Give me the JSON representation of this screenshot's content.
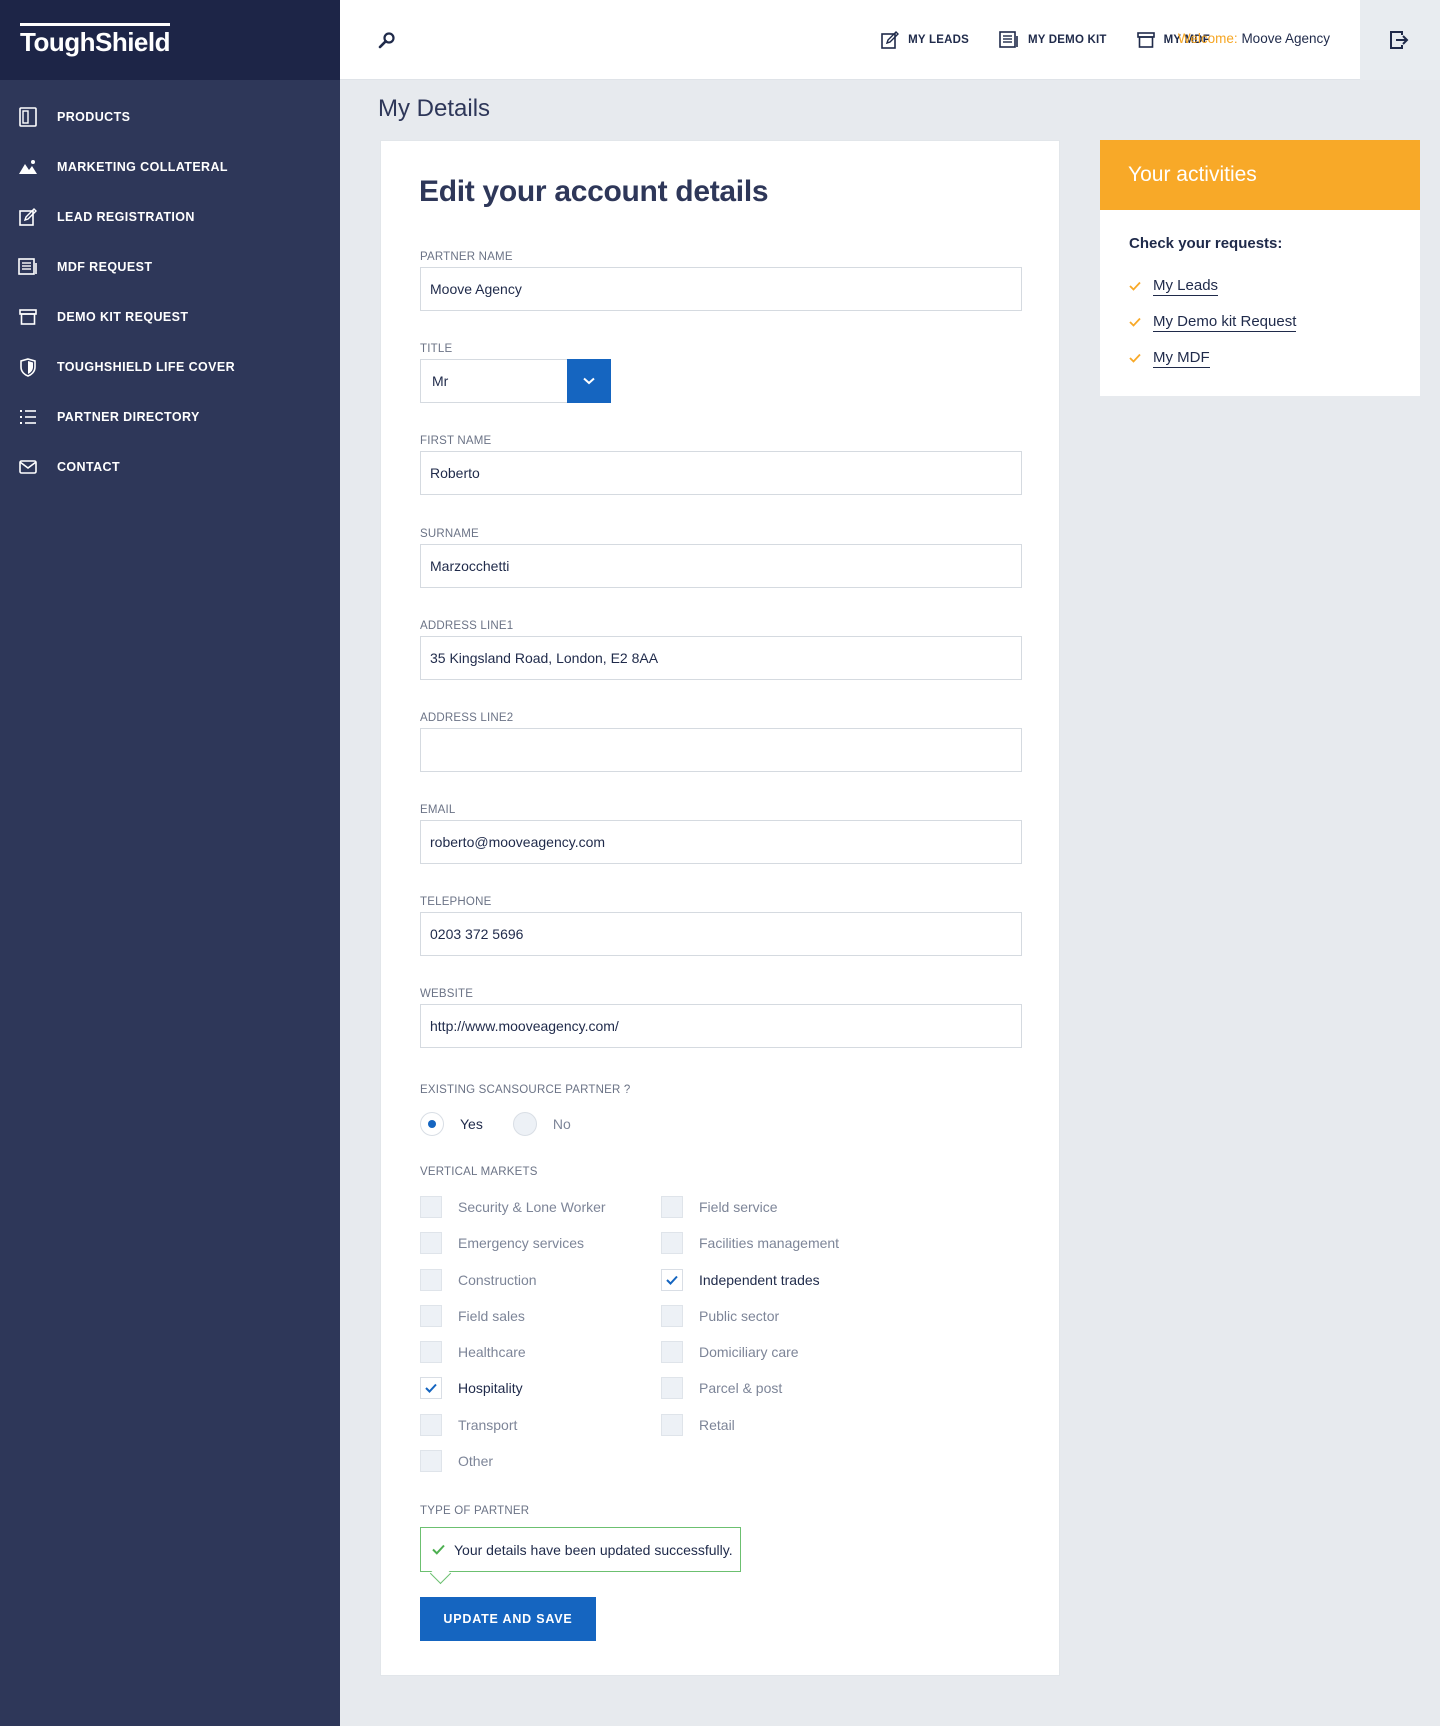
{
  "brand": {
    "logo_text": "ToughShield"
  },
  "sidebar": {
    "items": [
      {
        "label": "PRODUCTS",
        "icon": "tablet-icon"
      },
      {
        "label": "MARKETING COLLATERAL",
        "icon": "image-icon"
      },
      {
        "label": "LEAD REGISTRATION",
        "icon": "edit-icon"
      },
      {
        "label": "MDF REQUEST",
        "icon": "newspaper-icon"
      },
      {
        "label": "DEMO KIT REQUEST",
        "icon": "archive-box-icon"
      },
      {
        "label": "TOUGHSHIELD LIFE COVER",
        "icon": "shield-icon"
      },
      {
        "label": "PARTNER DIRECTORY",
        "icon": "list-icon"
      },
      {
        "label": "CONTACT",
        "icon": "envelope-icon"
      }
    ]
  },
  "header": {
    "nav": [
      {
        "label": "MY LEADS",
        "icon": "edit-icon"
      },
      {
        "label": "MY DEMO KIT",
        "icon": "newspaper-icon"
      },
      {
        "label": "MY MDF",
        "icon": "archive-box-icon"
      }
    ],
    "welcome_label": "Welcome:",
    "welcome_name": "Moove Agency",
    "search_icon": "search-icon",
    "logout_icon": "logout-icon"
  },
  "page": {
    "title": "My Details"
  },
  "form": {
    "heading": "Edit your account details",
    "partner_name": {
      "label": "PARTNER NAME",
      "value": "Moove Agency"
    },
    "title": {
      "label": "TITLE",
      "value": "Mr"
    },
    "first_name": {
      "label": "FIRST NAME",
      "value": "Roberto"
    },
    "surname": {
      "label": "SURNAME",
      "value": "Marzocchetti"
    },
    "address1": {
      "label": "ADDRESS LINE1",
      "value": "35 Kingsland Road, London, E2 8AA"
    },
    "address2": {
      "label": "ADDRESS LINE2",
      "value": ""
    },
    "email": {
      "label": "EMAIL",
      "value": "roberto@mooveagency.com"
    },
    "telephone": {
      "label": "TELEPHONE",
      "value": "0203 372 5696"
    },
    "website": {
      "label": "WEBSITE",
      "value": "http://www.mooveagency.com/"
    },
    "existing_partner": {
      "label": "EXISTING SCANSOURCE PARTNER ?",
      "options": [
        {
          "label": "Yes",
          "selected": true
        },
        {
          "label": "No",
          "selected": false
        }
      ]
    },
    "vertical_markets": {
      "label": "VERTICAL MARKETS",
      "left": [
        {
          "label": "Security & Lone Worker",
          "checked": false
        },
        {
          "label": "Emergency services",
          "checked": false
        },
        {
          "label": "Construction",
          "checked": false
        },
        {
          "label": "Field sales",
          "checked": false
        },
        {
          "label": "Healthcare",
          "checked": false
        },
        {
          "label": "Hospitality",
          "checked": true
        },
        {
          "label": "Transport",
          "checked": false
        },
        {
          "label": "Other",
          "checked": false
        }
      ],
      "right": [
        {
          "label": "Field service",
          "checked": false
        },
        {
          "label": "Facilities management",
          "checked": false
        },
        {
          "label": "Independent trades",
          "checked": true
        },
        {
          "label": "Public sector",
          "checked": false
        },
        {
          "label": "Domiciliary care",
          "checked": false
        },
        {
          "label": "Parcel & post",
          "checked": false
        },
        {
          "label": "Retail",
          "checked": false
        }
      ]
    },
    "type_of_partner": {
      "label": "TYPE OF PARTNER"
    },
    "success_message": "Your details have been updated successfully.",
    "submit_label": "UPDATE AND SAVE"
  },
  "activities": {
    "title": "Your activities",
    "subtitle": "Check your requests:",
    "links": [
      "My Leads",
      "My Demo kit Request",
      "My MDF"
    ]
  },
  "colors": {
    "sidebar_bg": "#2e3759",
    "logo_bar_bg": "#1d2547",
    "accent_blue": "#1565c0",
    "accent_orange": "#f8a928",
    "success_green": "#6cc070"
  }
}
